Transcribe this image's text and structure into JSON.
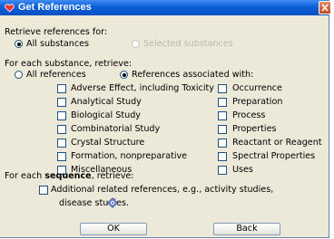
{
  "window": {
    "title": "Get References"
  },
  "retrieve_for": {
    "label": "Retrieve references for:",
    "options": [
      {
        "label": "All substances",
        "selected": true,
        "enabled": true
      },
      {
        "label": "Selected substances",
        "selected": false,
        "enabled": false
      }
    ]
  },
  "per_substance": {
    "label": "For each substance, retrieve:",
    "options": [
      {
        "label": "All references",
        "selected": false
      },
      {
        "label": "References associated with:",
        "selected": true
      }
    ],
    "left_checkboxes": [
      {
        "label": "Adverse Effect, including Toxicity",
        "checked": false
      },
      {
        "label": "Analytical Study",
        "checked": false
      },
      {
        "label": "Biological Study",
        "checked": false
      },
      {
        "label": "Combinatorial Study",
        "checked": false
      },
      {
        "label": "Crystal Structure",
        "checked": false
      },
      {
        "label": "Formation, nonpreparative",
        "checked": false
      },
      {
        "label": "Miscellaneous",
        "checked": false
      }
    ],
    "right_checkboxes": [
      {
        "label": "Occurrence",
        "checked": false
      },
      {
        "label": "Preparation",
        "checked": false
      },
      {
        "label": "Process",
        "checked": false
      },
      {
        "label": "Properties",
        "checked": false
      },
      {
        "label": "Reactant or Reagent",
        "checked": false
      },
      {
        "label": "Spectral Properties",
        "checked": false
      },
      {
        "label": "Uses",
        "checked": false
      }
    ]
  },
  "per_sequence": {
    "label_prefix": "For each ",
    "label_bold": "sequence",
    "label_suffix": ", retrieve:",
    "checkbox": {
      "line1": "Additional related references, e.g., activity studies,",
      "line2": "disease studies.",
      "checked": false
    },
    "info_icon": "info-icon"
  },
  "buttons": {
    "ok": "OK",
    "back": "Back"
  },
  "colors": {
    "title_bar": "#0a5fd8",
    "dialog_bg": "#ECE9D8",
    "close_button": "#c44b22"
  }
}
